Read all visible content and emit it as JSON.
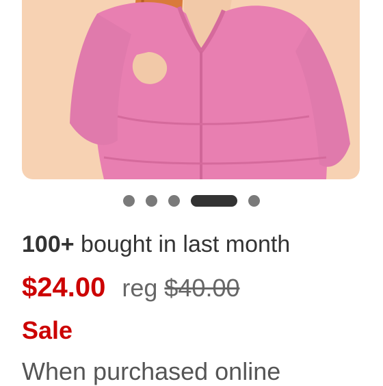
{
  "product": {
    "image_name": "pink-zip-hoodie-photo",
    "carousel": {
      "total": 5,
      "active_index": 3
    },
    "bought_count": "100+",
    "bought_text": "bought in last month",
    "sale_price": "$24.00",
    "reg_label": "reg",
    "reg_price": "$40.00",
    "sale_label": "Sale",
    "purchase_note": "When purchased online"
  },
  "colors": {
    "sale_red": "#cc0000",
    "text_dark": "#333333",
    "image_bg": "#f7d2b3",
    "hoodie_pink": "#e87fb1"
  }
}
